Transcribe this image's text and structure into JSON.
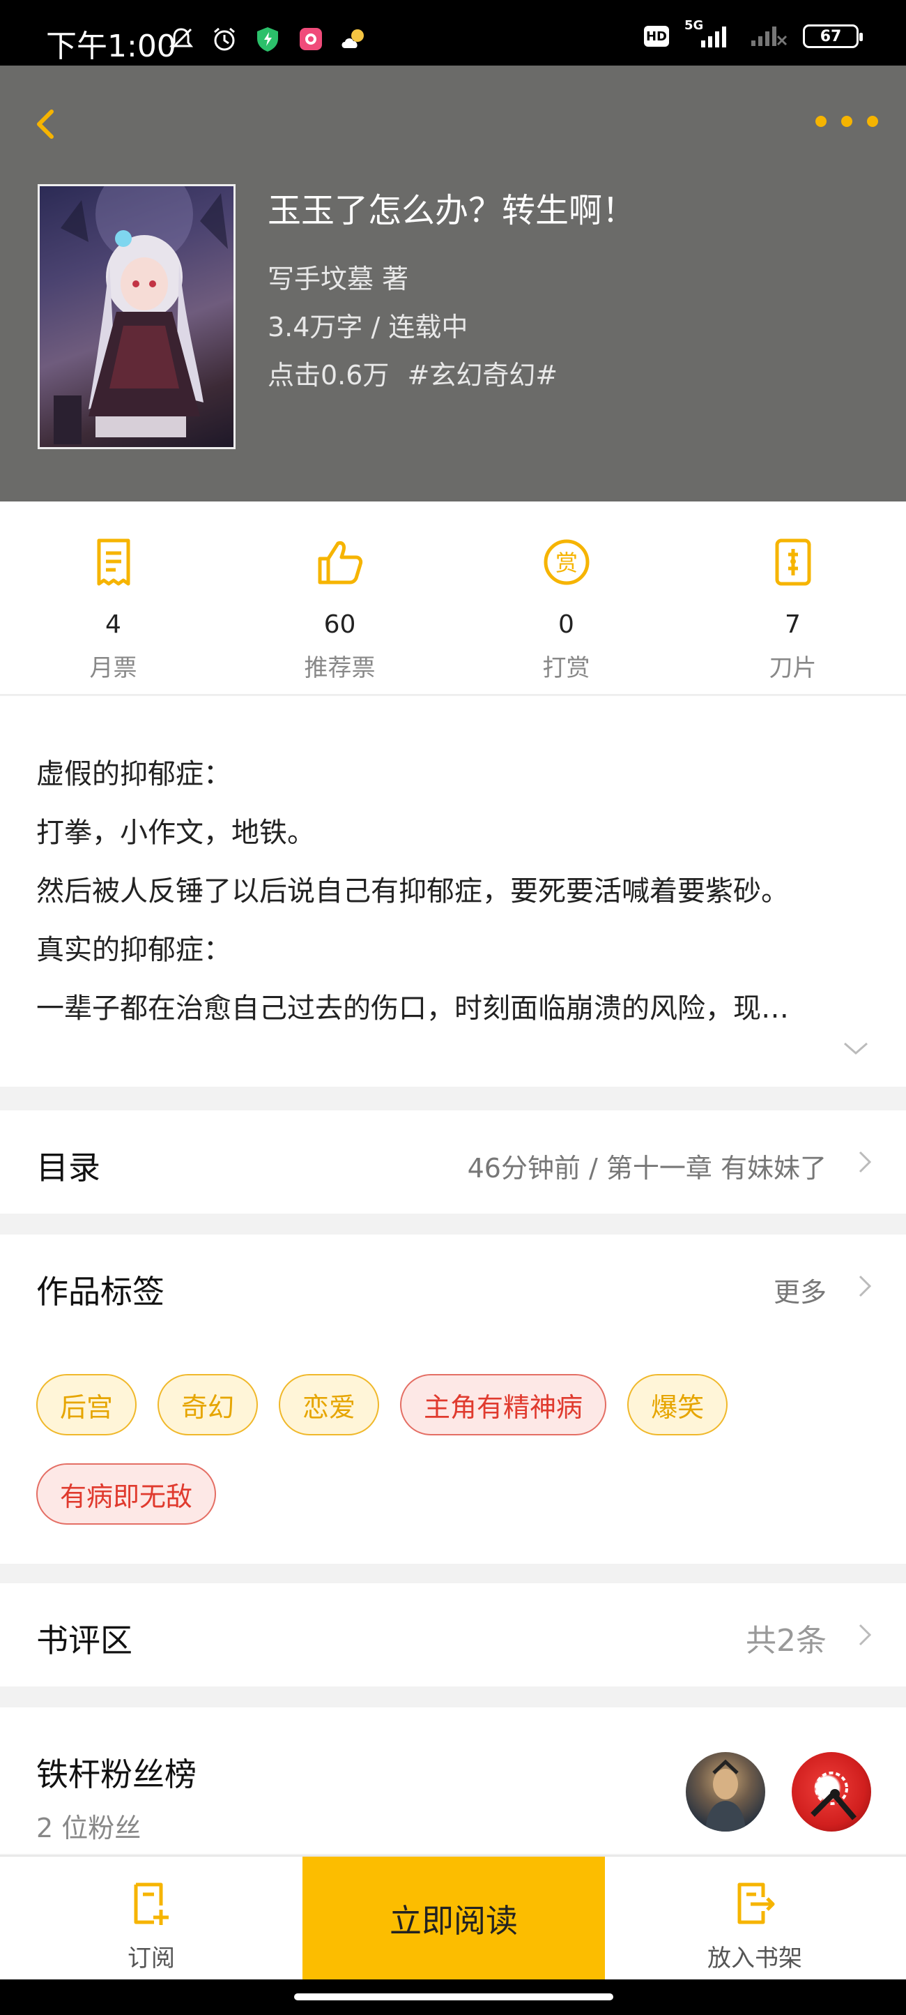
{
  "status_bar": {
    "time": "下午1:00",
    "network": "5G",
    "hd_label": "HD",
    "battery": "67"
  },
  "book": {
    "title": "玉玉了怎么办？转生啊！",
    "author_line": "写手坟墓  著",
    "words_status": "3.4万字 / 连载中",
    "clicks": "点击0.6万",
    "genre_tag": "#玄幻奇幻#"
  },
  "stats": [
    {
      "value": "4",
      "label": "月票",
      "icon": "monthly-ticket-icon"
    },
    {
      "value": "60",
      "label": "推荐票",
      "icon": "thumbs-up-icon"
    },
    {
      "value": "0",
      "label": "打赏",
      "icon": "reward-coin-icon"
    },
    {
      "value": "7",
      "label": "刀片",
      "icon": "blade-icon"
    }
  ],
  "synopsis": [
    "虚假的抑郁症：",
    "打拳，小作文，地铁。",
    "然后被人反锤了以后说自己有抑郁症，要死要活喊着要紫砂。",
    "真实的抑郁症：",
    "一辈子都在治愈自己过去的伤口，时刻面临崩溃的风险，现…"
  ],
  "catalog": {
    "title": "目录",
    "latest": "46分钟前 / 第十一章 有妹妹了"
  },
  "tags_section": {
    "title": "作品标签",
    "more": "更多",
    "tags": [
      {
        "label": "后宫",
        "style": "yellow"
      },
      {
        "label": "奇幻",
        "style": "yellow"
      },
      {
        "label": "恋爱",
        "style": "yellow"
      },
      {
        "label": "主角有精神病",
        "style": "red"
      },
      {
        "label": "爆笑",
        "style": "yellow"
      },
      {
        "label": "有病即无敌",
        "style": "red"
      }
    ]
  },
  "reviews": {
    "title": "书评区",
    "count": "共2条"
  },
  "fans": {
    "title": "铁杆粉丝榜",
    "count": "2 位粉丝"
  },
  "bottom_bar": {
    "subscribe": "订阅",
    "read_now": "立即阅读",
    "add_to_shelf": "放入书架"
  },
  "colors": {
    "accent": "#fcbd00",
    "header_bg": "#6b6b69",
    "tag_yellow": "#e6a500",
    "tag_red": "#e03a2e"
  }
}
